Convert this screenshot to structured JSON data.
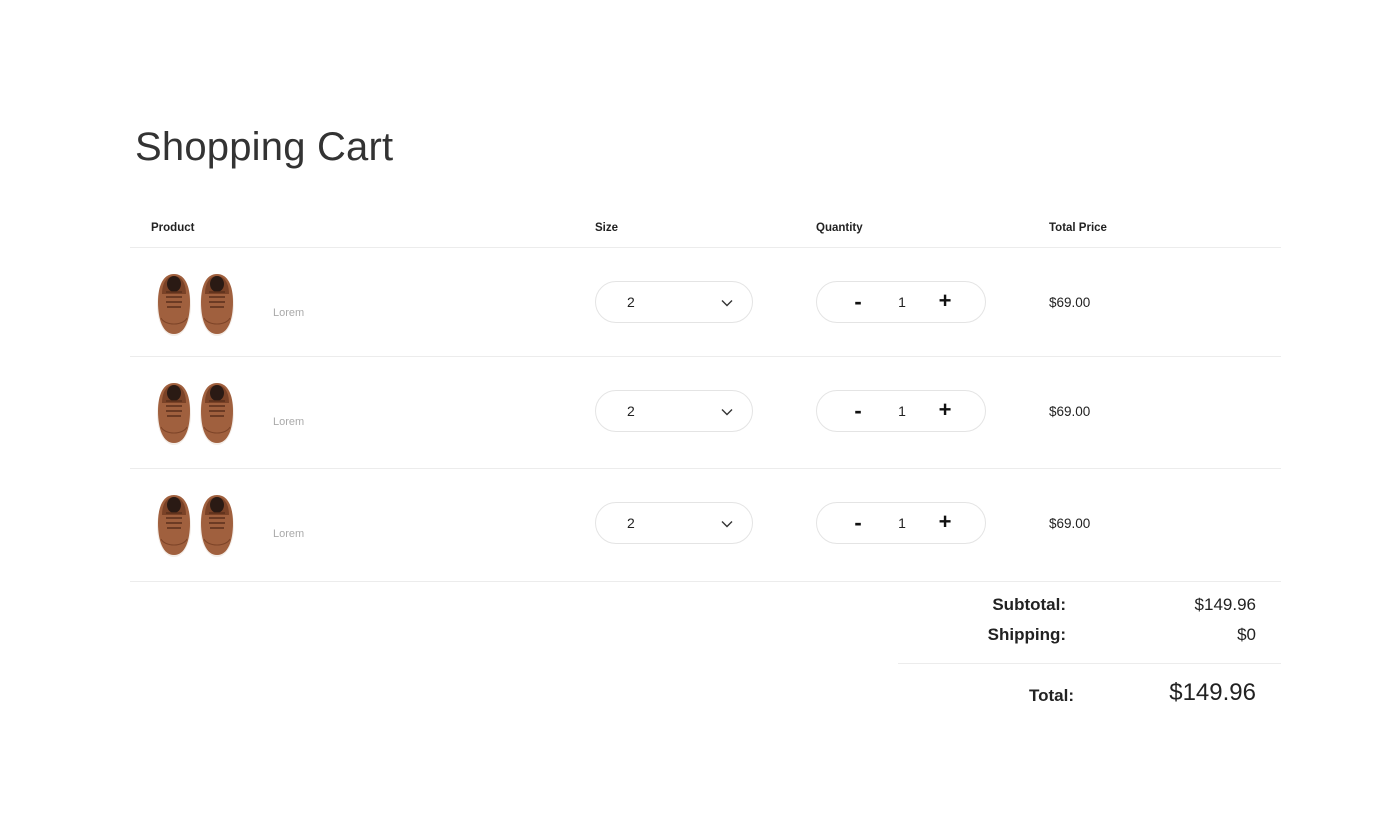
{
  "page": {
    "title": "Shopping Cart"
  },
  "table": {
    "headers": {
      "product": "Product",
      "size": "Size",
      "quantity": "Quantity",
      "total": "Total Price"
    },
    "rows": [
      {
        "name": "Lorem",
        "size": "2",
        "quantity": "1",
        "price": "$69.00",
        "image_icon": "brown-sneakers"
      },
      {
        "name": "Lorem",
        "size": "2",
        "quantity": "1",
        "price": "$69.00",
        "image_icon": "brown-sneakers"
      },
      {
        "name": "Lorem",
        "size": "2",
        "quantity": "1",
        "price": "$69.00",
        "image_icon": "brown-sneakers"
      }
    ],
    "qty_minus": "-",
    "qty_plus": "+"
  },
  "summary": {
    "subtotal_label": "Subtotal:",
    "subtotal_value": "$149.96",
    "shipping_label": "Shipping:",
    "shipping_value": "$0",
    "total_label": "Total:",
    "total_value": "$149.96"
  },
  "colors": {
    "shoe": "#9a5a3a",
    "border": "#e4e4e4",
    "muted_text": "#aaaaaa"
  }
}
